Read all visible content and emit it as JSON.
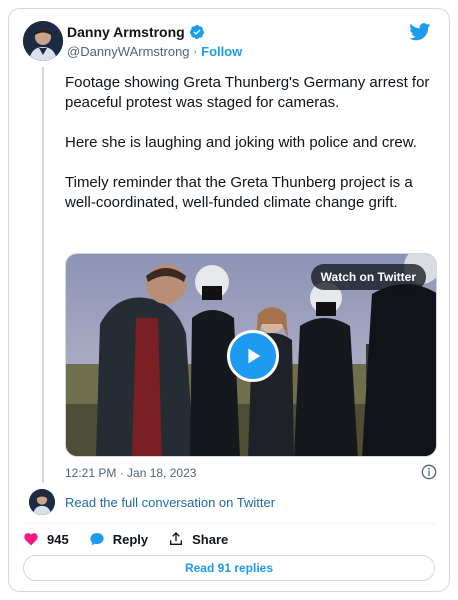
{
  "author": {
    "name": "Danny Armstrong",
    "handle": "@DannyWArmstrong",
    "separator": "·",
    "follow_label": "Follow"
  },
  "tweet": {
    "paragraphs": [
      "Footage showing Greta Thunberg's Germany arrest for peaceful protest was staged for cameras.",
      "Here she is laughing and joking with police and crew.",
      "Timely reminder that the Greta Thunberg project is a well-coordinated, well-funded climate change grift."
    ],
    "timestamp": "12:21 PM · Jan 18, 2023"
  },
  "media": {
    "watch_label": "Watch on Twitter"
  },
  "conversation": {
    "link_label": "Read the full conversation on Twitter"
  },
  "actions": {
    "likes": "945",
    "reply_label": "Reply",
    "share_label": "Share"
  },
  "replies": {
    "label": "Read 91 replies"
  },
  "colors": {
    "accent": "#1d9bf0",
    "like": "#f91880",
    "border": "#cfd9de",
    "muted": "#536471"
  },
  "icons": [
    "verified-badge-icon",
    "twitter-bird-icon",
    "play-icon",
    "info-icon",
    "heart-icon",
    "reply-icon",
    "share-icon"
  ]
}
